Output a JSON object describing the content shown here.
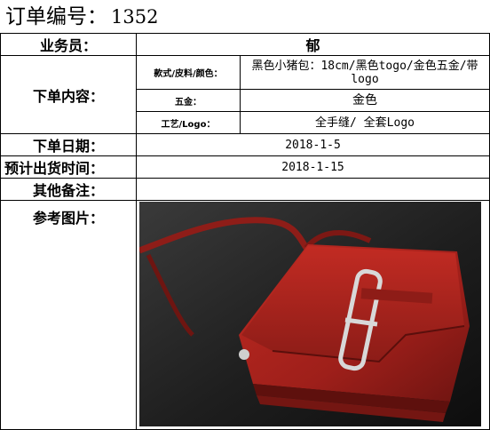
{
  "order": {
    "title_label": "订单编号：",
    "number": "1352"
  },
  "rows": {
    "salesperson": {
      "label": "业务员：",
      "value": "郁"
    },
    "order_content": {
      "label": "下单内容：",
      "style": {
        "label": "款式/皮料/颜色：",
        "value": "黑色小猪包：18cm/黑色togo/金色五金/带logo"
      },
      "hardware": {
        "label": "五金：",
        "value": "金色"
      },
      "craft": {
        "label": "工艺/Logo：",
        "value": "全手缝/ 全套Logo"
      }
    },
    "order_date": {
      "label": "下单日期：",
      "value": "2018-1-5"
    },
    "ship_date": {
      "label": "预计出货时间：",
      "value": "2018-1-15"
    },
    "remarks": {
      "label": "其他备注：",
      "value": ""
    },
    "reference": {
      "label": "参考图片："
    }
  },
  "colors": {
    "bag_red": "#a8231d",
    "background": "#1d1d1d",
    "hardware_silver": "#d8d8d8"
  }
}
